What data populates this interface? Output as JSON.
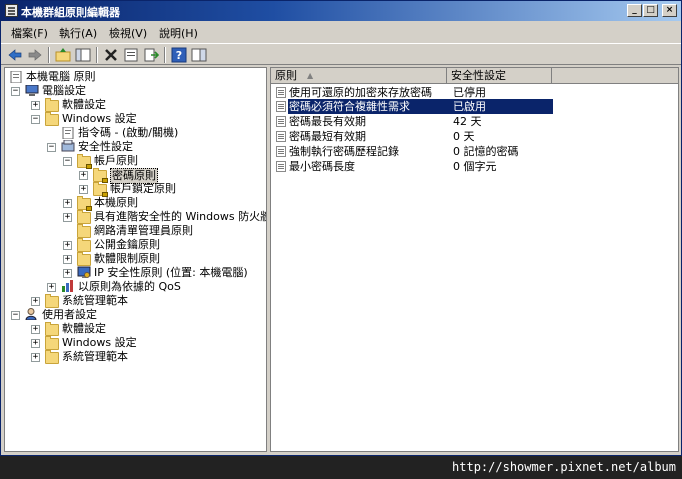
{
  "window": {
    "title": "本機群組原則編輯器"
  },
  "menu": [
    {
      "label": "檔案(F)"
    },
    {
      "label": "執行(A)"
    },
    {
      "label": "檢視(V)"
    },
    {
      "label": "說明(H)"
    }
  ],
  "tree": {
    "root": "本機電腦 原則",
    "computer_config": "電腦設定",
    "cc_software": "軟體設定",
    "cc_windows": "Windows 設定",
    "script": "指令碼 - (啟動/關機)",
    "security": "安全性設定",
    "account_policy": "帳戶原則",
    "password_policy": "密碼原則",
    "lockout_policy": "帳戶鎖定原則",
    "local_policy": "本機原則",
    "firewall": "具有進階安全性的 Windows 防火牆",
    "network_list": "網路清單管理員原則",
    "public_key": "公開金鑰原則",
    "software_restriction": "軟體限制原則",
    "ipsec": "IP 安全性原則 (位置: 本機電腦)",
    "qos": "以原則為依據的 QoS",
    "cc_admin": "系統管理範本",
    "user_config": "使用者設定",
    "uc_software": "軟體設定",
    "uc_windows": "Windows 設定",
    "uc_admin": "系統管理範本"
  },
  "list": {
    "col_policy": "原則",
    "col_setting": "安全性設定",
    "rows": [
      {
        "policy": "使用可還原的加密來存放密碼",
        "setting": "已停用"
      },
      {
        "policy": "密碼必須符合複雜性需求",
        "setting": "已啟用"
      },
      {
        "policy": "密碼最長有效期",
        "setting": "42 天"
      },
      {
        "policy": "密碼最短有效期",
        "setting": "0 天"
      },
      {
        "policy": "強制執行密碼歷程記錄",
        "setting": "0 記憶的密碼"
      },
      {
        "policy": "最小密碼長度",
        "setting": "0 個字元"
      }
    ]
  },
  "watermark": "http://showmer.pixnet.net/album"
}
